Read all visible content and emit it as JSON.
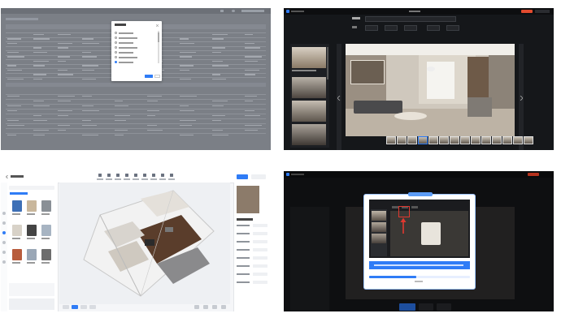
{
  "panel1": {
    "header": {
      "title": "",
      "right_items": [
        "",
        "",
        ""
      ]
    },
    "modal": {
      "title": "",
      "options": [
        "",
        "",
        "",
        "",
        "",
        "",
        ""
      ],
      "selected_index": 6,
      "ok_label": "",
      "cancel_label": ""
    },
    "colors": {
      "overlay": "#7b7f86",
      "modal": "#ffffff",
      "accent": "#2f7cf6"
    }
  },
  "panel2": {
    "header": {
      "title": "",
      "right_badge": "",
      "left_logo": ""
    },
    "toolbar": {
      "fields": [
        "",
        "",
        "",
        "",
        ""
      ]
    },
    "main_view": {
      "scene": "living-room-render"
    },
    "actions": {
      "primary_label": "",
      "secondary_label": "",
      "tertiary_label": "",
      "more_label": "..."
    },
    "colors": {
      "bg": "#15171a",
      "primary": "#2f7cf6",
      "accent_badge": "#e24b2f"
    }
  },
  "panel3": {
    "left": {
      "brand": "",
      "search_placeholder": "",
      "section_title": ""
    },
    "right": {
      "title": "",
      "rows": [
        "",
        "",
        "",
        "",
        ""
      ]
    },
    "bottom_tools": [
      "",
      "",
      "",
      ""
    ],
    "colors": {
      "accent": "#2f7cf6",
      "floor": "#5a3d2b",
      "wall": "#f2f2f2"
    }
  },
  "panel4": {
    "dialog": {
      "title": "",
      "tip_text": "",
      "progress_label": ""
    },
    "actions": {
      "primary_label": "",
      "secondary_label": "",
      "tertiary_label": ""
    },
    "colors": {
      "dialog_border": "#9cc3ff",
      "banner": "#2f7cf6",
      "arrow": "#e0382f"
    }
  }
}
